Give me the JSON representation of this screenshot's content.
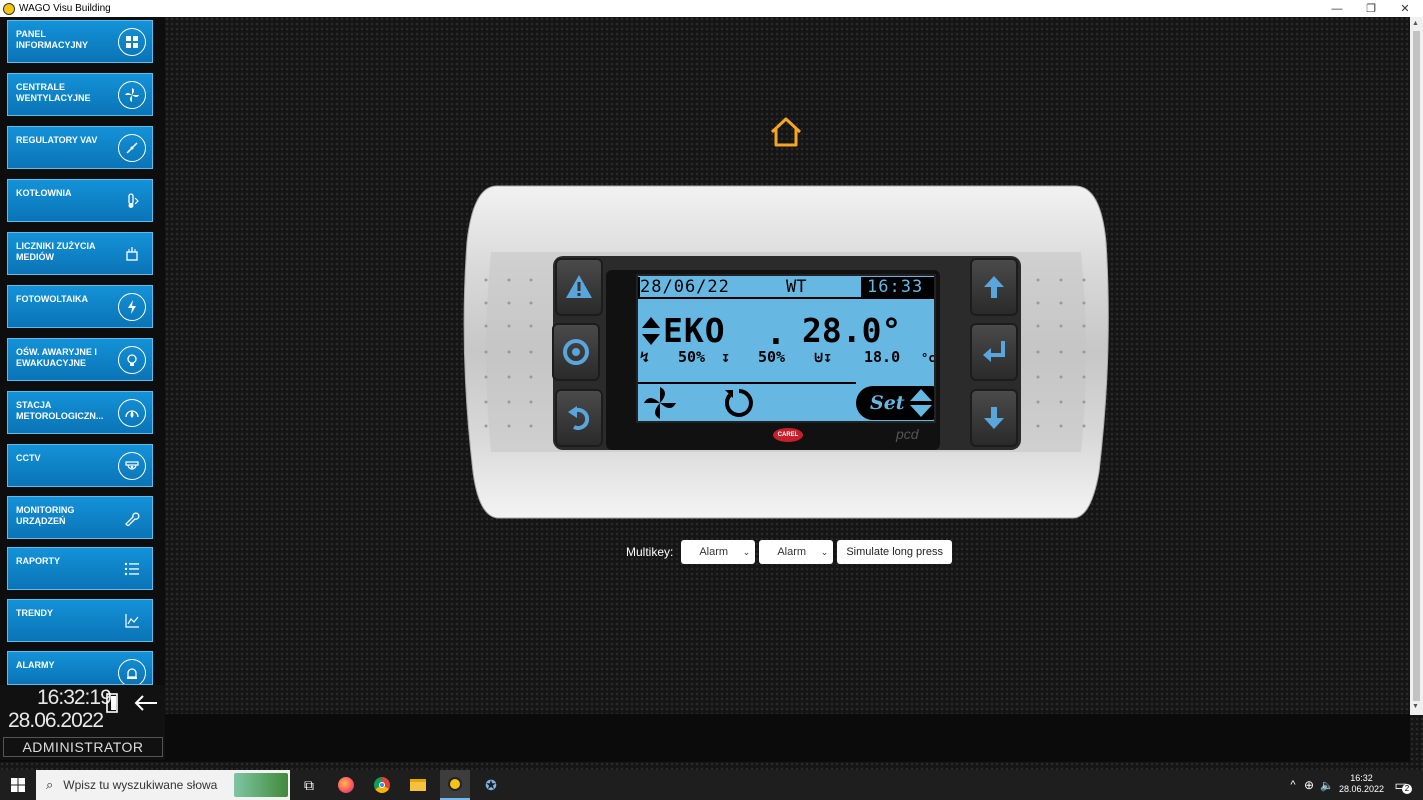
{
  "window": {
    "title": "WAGO Visu Building"
  },
  "sidebar": {
    "items": [
      {
        "label": "PANEL INFORMACYJNY",
        "icon": "dashboard-icon"
      },
      {
        "label": "CENTRALE WENTYLACYJNE",
        "icon": "fan-icon"
      },
      {
        "label": "REGULATORY VAV",
        "icon": "damper-icon"
      },
      {
        "label": "KOTŁOWNIA",
        "icon": "thermometer-icon"
      },
      {
        "label": "LICZNIKI ZUŻYCIA MEDIÓW",
        "icon": "meter-icon"
      },
      {
        "label": "FOTOWOLTAIKA",
        "icon": "lightning-icon"
      },
      {
        "label": "OŚW. AWARYJNE I EWAKUACYJNE",
        "icon": "bulb-icon"
      },
      {
        "label": "STACJA METOROLOGICZN...",
        "icon": "weather-icon"
      },
      {
        "label": "CCTV",
        "icon": "camera-icon"
      },
      {
        "label": "MONITORING URZĄDZEŃ",
        "icon": "wrench-icon"
      },
      {
        "label": "RAPORTY",
        "icon": "list-icon"
      },
      {
        "label": "TRENDY",
        "icon": "trend-icon"
      },
      {
        "label": "ALARMY",
        "icon": "alarm-icon"
      }
    ]
  },
  "status": {
    "time": "16:32:19",
    "date": "28.06.2022",
    "user": "ADMINISTRATOR"
  },
  "lcd": {
    "date": "28/06/22",
    "day": "WT",
    "time": "16:33",
    "mode": "EKO",
    "temperature": "28.0°",
    "fan1": "50%",
    "fan2": "50%",
    "setpoint": "18.0",
    "set_label": "Set",
    "brand": "CAREL",
    "model": "pcd"
  },
  "multikey": {
    "label": "Multikey:",
    "select1": "Alarm",
    "select2": "Alarm",
    "button": "Simulate long press"
  },
  "taskbar": {
    "search_placeholder": "Wpisz tu wyszukiwane słowa",
    "time": "16:32",
    "date": "28.06.2022",
    "notifications": "2"
  },
  "colors": {
    "accent": "#0a80c8",
    "lcd": "#66b8e3",
    "home": "#f5a623"
  }
}
